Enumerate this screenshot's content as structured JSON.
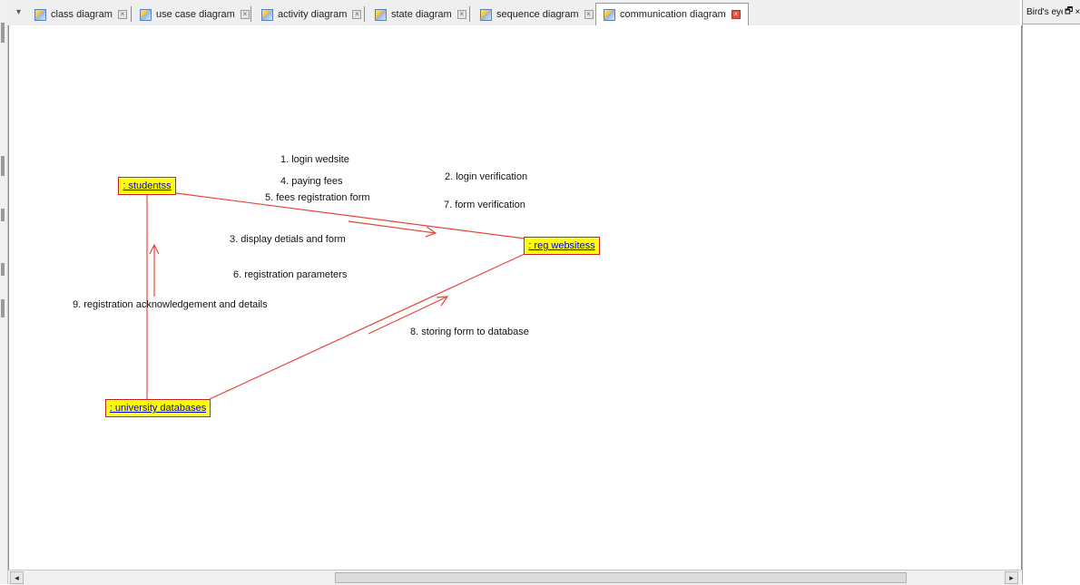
{
  "tabs": [
    {
      "label": "class diagram",
      "active": false
    },
    {
      "label": "use case diagram",
      "active": false
    },
    {
      "label": "activity diagram",
      "active": false
    },
    {
      "label": "state diagram",
      "active": false
    },
    {
      "label": "sequence diagram",
      "active": false
    },
    {
      "label": "communication diagram",
      "active": true
    }
  ],
  "birdseye": {
    "title": "Bird's eye",
    "restore_glyph": "🗗",
    "close_glyph": "×"
  },
  "diagram": {
    "objects": {
      "students": ": studentss",
      "reg_website": ": reg websitess",
      "university_db": ": university databases"
    },
    "messages": {
      "m1": "1. login wedsite",
      "m2": "2. login verification",
      "m3": "3. display detials and form",
      "m4": "4. paying fees",
      "m5": "5. fees registration form",
      "m6": "6. registration parameters",
      "m7": "7. form verification",
      "m8": "8. storing form to database",
      "m9": "9. registration acknowledgement and details"
    },
    "link_color": "#e8463a",
    "object_fill": "#ffff00",
    "object_text_color": "#0000cc"
  },
  "scrollbar": {
    "left_arrow": "◂",
    "right_arrow": "▸"
  }
}
